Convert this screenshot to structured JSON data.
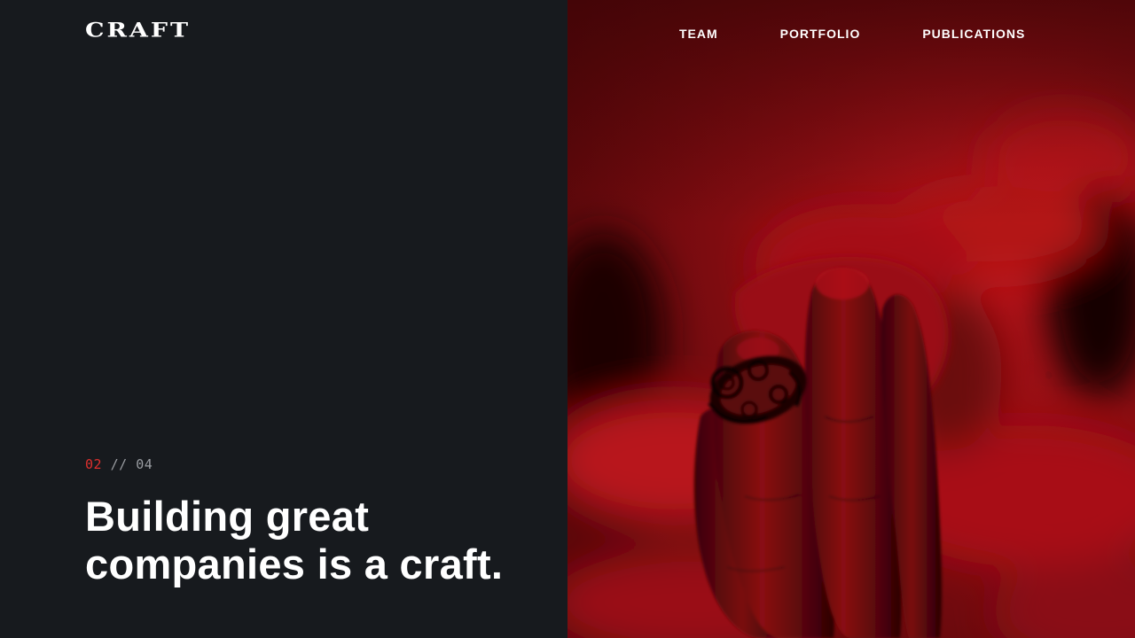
{
  "brand": {
    "logo_text": "CRAFT"
  },
  "nav": {
    "items": [
      {
        "label": "TEAM"
      },
      {
        "label": "PORTFOLIO"
      },
      {
        "label": "PUBLICATIONS"
      }
    ]
  },
  "hero": {
    "slide_current": "02",
    "slide_separator": " // ",
    "slide_total": "04",
    "headline": "Building great companies is a craft."
  },
  "image": {
    "subject": "hand-with-ring-photo",
    "tint_color": "#b3121a"
  },
  "colors": {
    "background": "#171a1e",
    "accent": "#e0302e",
    "text": "#ffffff",
    "muted": "#9a9da2"
  }
}
